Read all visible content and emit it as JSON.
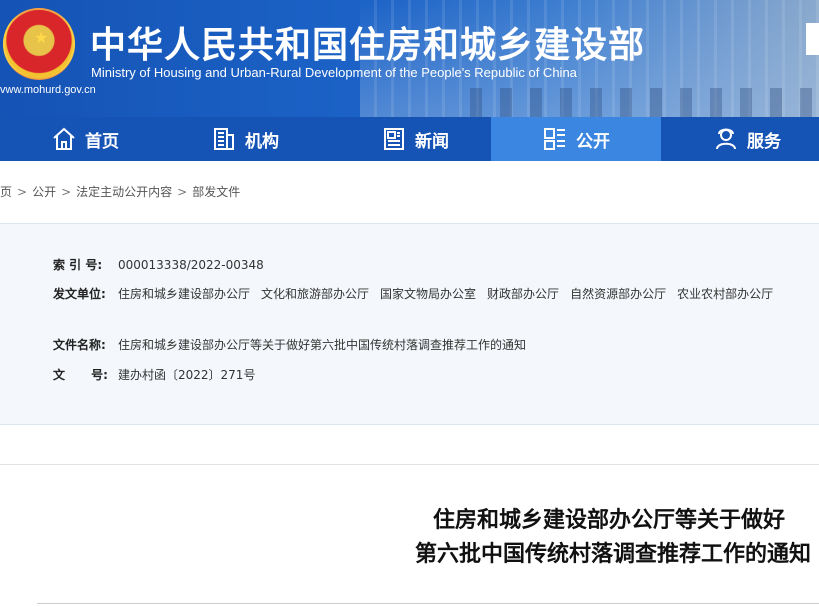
{
  "header": {
    "title": "中华人民共和国住房和城乡建设部",
    "subtitle": "Ministry of Housing and Urban-Rural Development of the People's Republic of China",
    "url": "vww.mohurd.gov.cn",
    "emblem_icon": "national-emblem-icon",
    "colors": {
      "banner": "#1553b5",
      "nav": "#1553b5",
      "nav_active": "#3a86e0"
    }
  },
  "nav": {
    "items": [
      {
        "label": "首页",
        "icon": "home-icon",
        "active": false
      },
      {
        "label": "机构",
        "icon": "building-icon",
        "active": false
      },
      {
        "label": "新闻",
        "icon": "news-icon",
        "active": false
      },
      {
        "label": "公开",
        "icon": "document-icon",
        "active": true
      },
      {
        "label": "服务",
        "icon": "service-user-icon",
        "active": false
      }
    ]
  },
  "breadcrumb": {
    "items": [
      "页",
      "公开",
      "法定主动公开内容",
      "部发文件"
    ],
    "separator": ">"
  },
  "info": {
    "index": {
      "label": "索 引 号:",
      "value": "000013338/2022-00348"
    },
    "issuers": {
      "label": "发文单位:",
      "values": [
        "住房和城乡建设部办公厅",
        "文化和旅游部办公厅",
        "国家文物局办公室",
        "财政部办公厅",
        "自然资源部办公厅",
        "农业农村部办公厅"
      ]
    },
    "doc_name": {
      "label": "文件名称:",
      "value": "住房和城乡建设部办公厅等关于做好第六批中国传统村落调查推荐工作的通知"
    },
    "doc_number": {
      "label": "文 号:",
      "value": "建办村函〔2022〕271号"
    }
  },
  "document": {
    "title_line1": "住房和城乡建设部办公厅等关于做好",
    "title_line2": "第六批中国传统村落调查推荐工作的通知"
  }
}
